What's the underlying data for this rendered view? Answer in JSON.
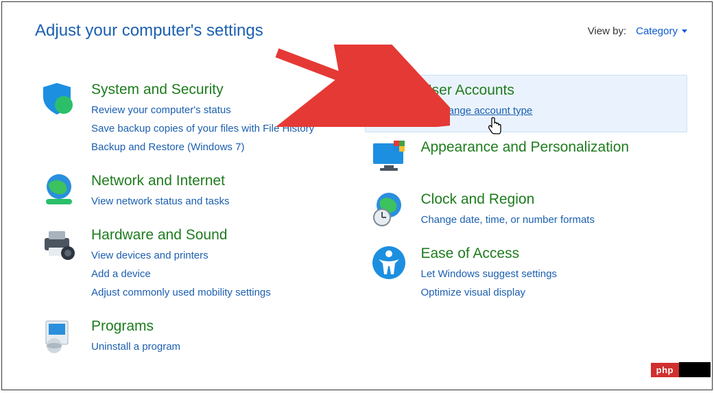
{
  "header": {
    "title": "Adjust your computer's settings",
    "viewby_label": "View by:",
    "viewby_value": "Category"
  },
  "left": {
    "system": {
      "title": "System and Security",
      "links": [
        "Review your computer's status",
        "Save backup copies of your files with File History",
        "Backup and Restore (Windows 7)"
      ]
    },
    "network": {
      "title": "Network and Internet",
      "links": [
        "View network status and tasks"
      ]
    },
    "hardware": {
      "title": "Hardware and Sound",
      "links": [
        "View devices and printers",
        "Add a device",
        "Adjust commonly used mobility settings"
      ]
    },
    "programs": {
      "title": "Programs",
      "links": [
        "Uninstall a program"
      ]
    }
  },
  "right": {
    "user": {
      "title": "User Accounts",
      "links": [
        "Change account type"
      ]
    },
    "appearance": {
      "title": "Appearance and Personalization"
    },
    "clock": {
      "title": "Clock and Region",
      "links": [
        "Change date, time, or number formats"
      ]
    },
    "ease": {
      "title": "Ease of Access",
      "links": [
        "Let Windows suggest settings",
        "Optimize visual display"
      ]
    }
  },
  "watermark": {
    "text": "php"
  }
}
